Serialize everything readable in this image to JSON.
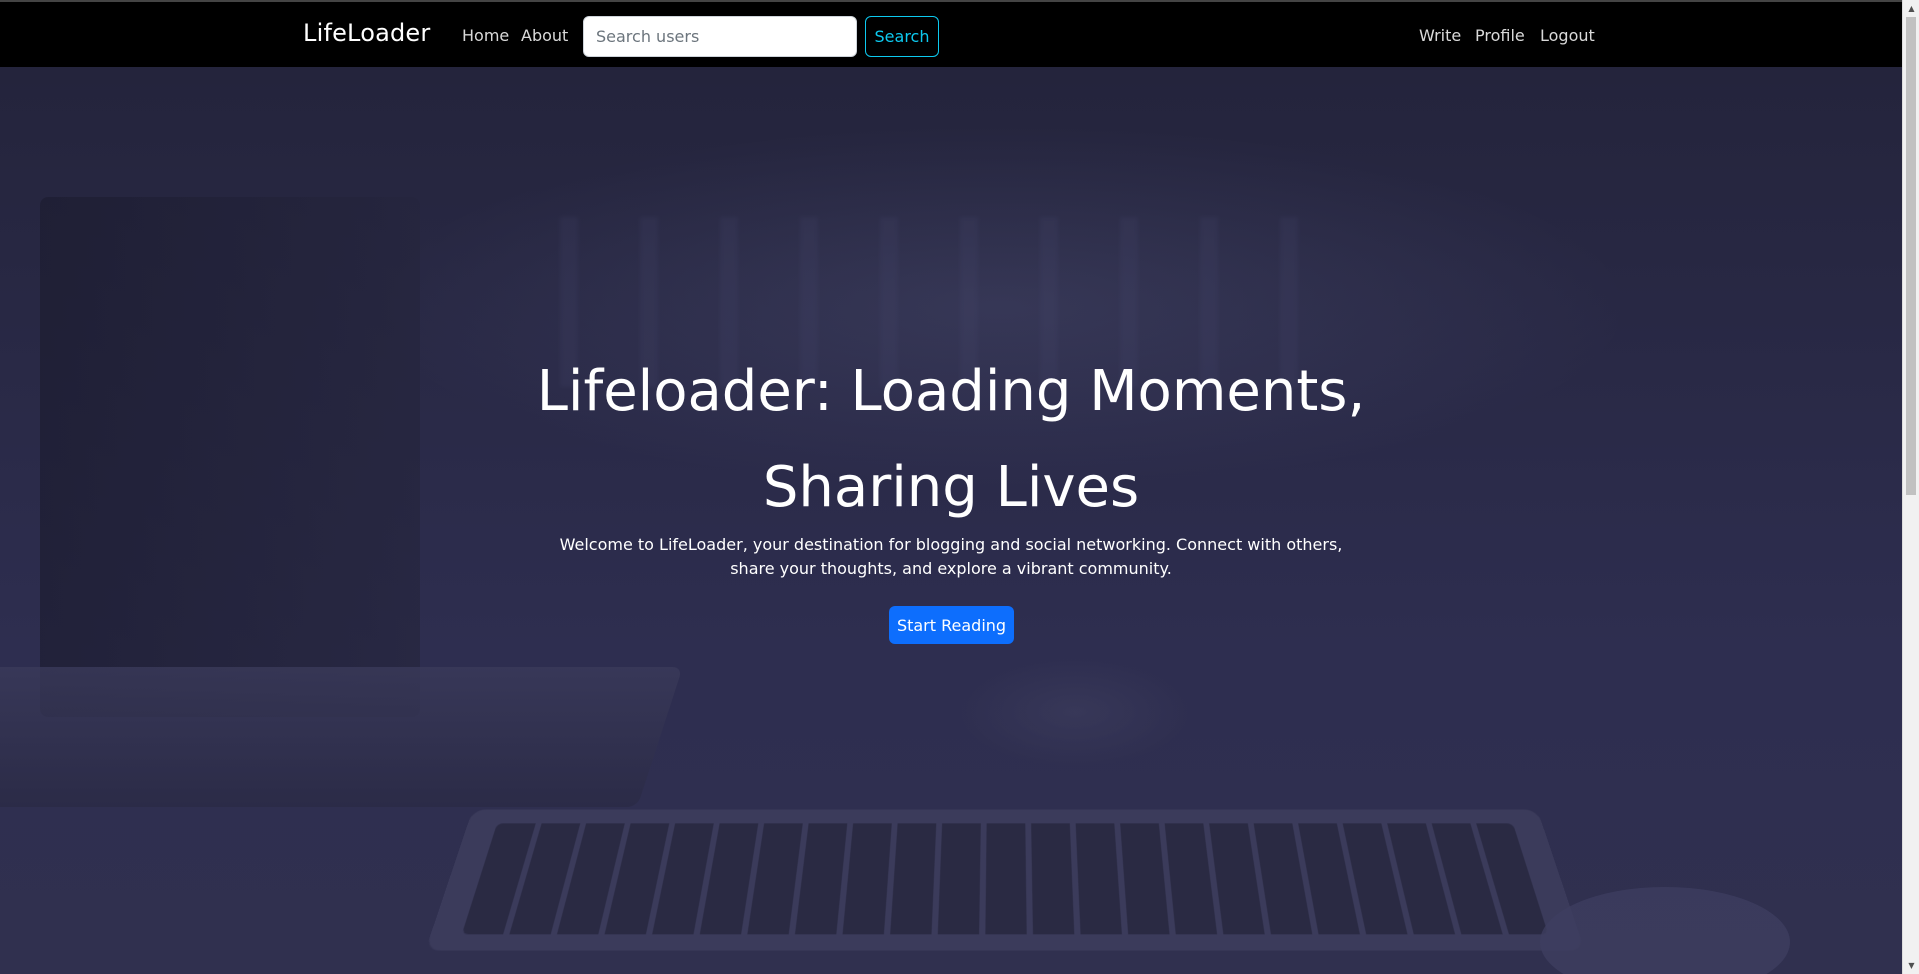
{
  "navbar": {
    "brand": "LifeLoader",
    "links": [
      {
        "label": "Home"
      },
      {
        "label": "About"
      }
    ],
    "search": {
      "placeholder": "Search users",
      "value": "",
      "button_label": "Search"
    },
    "right_links": [
      {
        "label": "Write"
      },
      {
        "label": "Profile"
      },
      {
        "label": "Logout"
      }
    ]
  },
  "hero": {
    "title_line1": "Lifeloader: Loading Moments,",
    "title_line2": "Sharing Lives",
    "subtitle": "Welcome to LifeLoader, your destination for blogging and social networking. Connect with others, share your thoughts, and explore a vibrant community.",
    "cta_label": "Start Reading"
  },
  "colors": {
    "navbar_bg": "#000000",
    "search_button": "#0dcaf0",
    "primary_button": "#0d6efd",
    "hero_overlay": "#2a2a48"
  },
  "icons": {
    "scroll_up": "scroll-up-arrow-icon",
    "scroll_down": "scroll-down-arrow-icon"
  }
}
